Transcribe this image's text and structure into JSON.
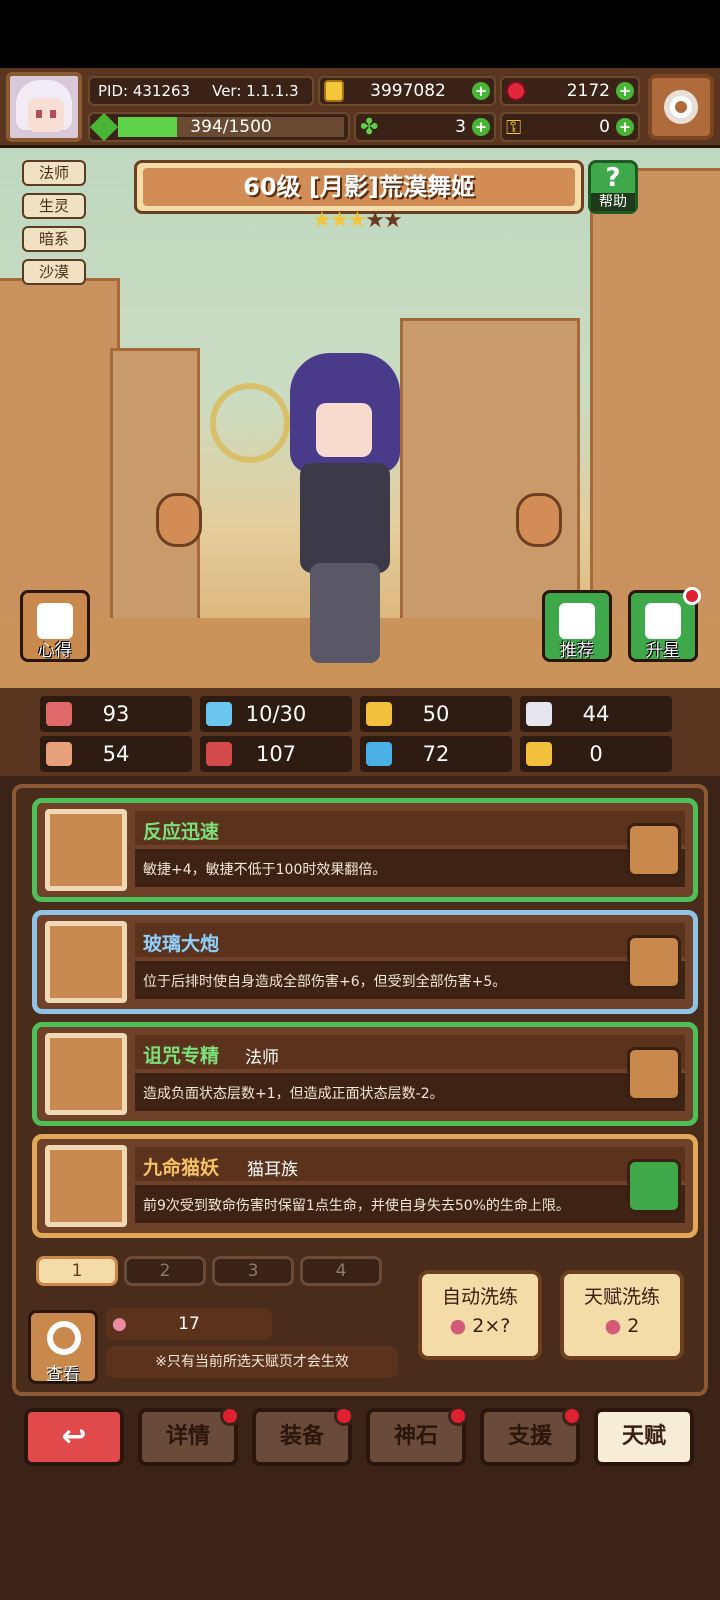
{
  "header": {
    "pid": "PID: 431263",
    "version": "Ver: 1.1.1.3",
    "gold": "3997082",
    "gems": "2172",
    "energy": "394/1500",
    "clover": "3",
    "keys": "0"
  },
  "energy_fraction": 0.263,
  "character": {
    "tags": [
      "法师",
      "生灵",
      "暗系",
      "沙漠"
    ],
    "title": "60级 [月影]荒漠舞姬",
    "stars_filled": 3,
    "stars_total": 5,
    "help_label": "帮助",
    "insights_label": "心得",
    "recommend_label": "推荐",
    "star_up_label": "升星"
  },
  "stats": [
    {
      "icon": "heart-icon",
      "value": "93",
      "color": "#e06a6a"
    },
    {
      "icon": "drop-icon",
      "value": "10/30",
      "color": "#6ac6ef"
    },
    {
      "icon": "shield-icon",
      "value": "50",
      "color": "#f2c03c"
    },
    {
      "icon": "wing-icon",
      "value": "44",
      "color": "#e6e6ee"
    },
    {
      "icon": "fist-icon",
      "value": "54",
      "color": "#e8a07a"
    },
    {
      "icon": "book-icon",
      "value": "107",
      "color": "#d44a4a"
    },
    {
      "icon": "boot-icon",
      "value": "72",
      "color": "#4ab0e6"
    },
    {
      "icon": "magnet-icon",
      "value": "0",
      "color": "#f2c03c"
    }
  ],
  "talents": [
    {
      "name": "反应迅速",
      "tag": "",
      "desc": "敏捷+4，敏捷不低于100时效果翻倍。",
      "border": "#4fbf5a",
      "name_color": "#7be07a",
      "icon": "plus-cross-icon",
      "locked": false
    },
    {
      "name": "玻璃大炮",
      "tag": "",
      "desc": "位于后排时使自身造成全部伤害+6，但受到全部伤害+5。",
      "border": "#8fc3e6",
      "name_color": "#8fd0ff",
      "icon": "plus-cross-icon",
      "locked": false
    },
    {
      "name": "诅咒专精",
      "tag": "法师",
      "desc": "造成负面状态层数+1，但造成正面状态层数-2。",
      "border": "#4fbf5a",
      "name_color": "#7be07a",
      "icon": "wand-icon",
      "locked": false
    },
    {
      "name": "九命猫妖",
      "tag": "猫耳族",
      "desc": "前9次受到致命伤害时保留1点生命，并使自身失去50%的生命上限。",
      "border": "#e0a85a",
      "name_color": "#f5c266",
      "icon": "cat-icon",
      "locked": true
    }
  ],
  "talent_pages": [
    "1",
    "2",
    "3",
    "4"
  ],
  "active_page": 0,
  "bottom": {
    "view_label": "查看",
    "fruit_count": "17",
    "note": "※只有当前所选天赋页才会生效",
    "auto_refine_label": "自动洗练",
    "auto_refine_cost": "2×?",
    "talent_refine_label": "天赋洗练",
    "talent_refine_cost": "2"
  },
  "nav": {
    "back_icon": "return-arrow-icon",
    "tabs": [
      "详情",
      "装备",
      "神石",
      "支援",
      "天赋"
    ]
  }
}
